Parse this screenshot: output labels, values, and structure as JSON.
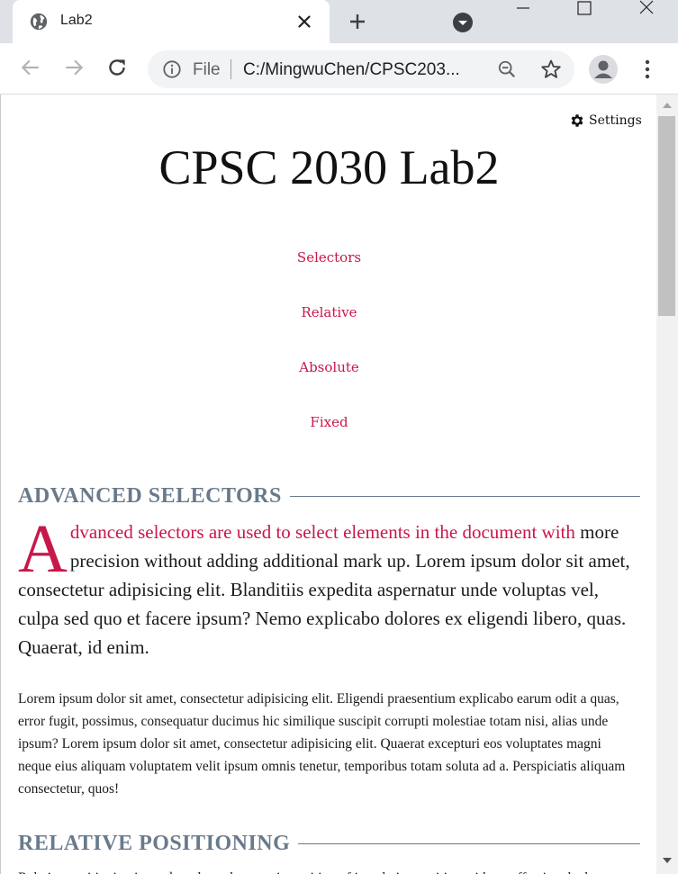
{
  "browser": {
    "tab": {
      "title": "Lab2"
    },
    "address_bar": {
      "scheme_label": "File",
      "url": "C:/MingwuChen/CPSC203..."
    }
  },
  "page": {
    "settings_label": "Settings",
    "title": "CPSC 2030 Lab2",
    "nav_links": [
      "Selectors",
      "Relative",
      "Absolute",
      "Fixed"
    ],
    "sections": [
      {
        "heading": "ADVANCED SELECTORS",
        "drop_cap": "A",
        "lead_accent": "dvanced selectors are used to select elements in the document with",
        "lead_rest": " more precision without adding additional mark up. Lorem ipsum dolor sit amet, consectetur adipisicing elit. Blanditiis expedita aspernatur unde voluptas vel, culpa sed quo et facere ipsum? Nemo explicabo dolores ex eligendi libero, quas. Quaerat, id enim.",
        "paragraph": "Lorem ipsum dolor sit amet, consectetur adipisicing elit. Eligendi praesentium explicabo earum odit a quas, error fugit, possimus, consequatur ducimus hic similique suscipit corrupti molestiae totam nisi, alias unde ipsum? Lorem ipsum dolor sit amet, consectetur adipisicing elit. Quaerat excepturi eos voluptates magni neque eius aliquam voluptatem velit ipsum omnis tenetur, temporibus totam soluta ad a. Perspiciatis aliquam consectetur, quos!"
      },
      {
        "heading": "RELATIVE POSITIONING",
        "paragraph_partial": "Relative positioning is used to place elements in position of its relative position without affecting the layout"
      }
    ]
  },
  "colors": {
    "accent": "#c8184a",
    "heading": "#6a7a8c",
    "chrome": "#dee1e6"
  }
}
